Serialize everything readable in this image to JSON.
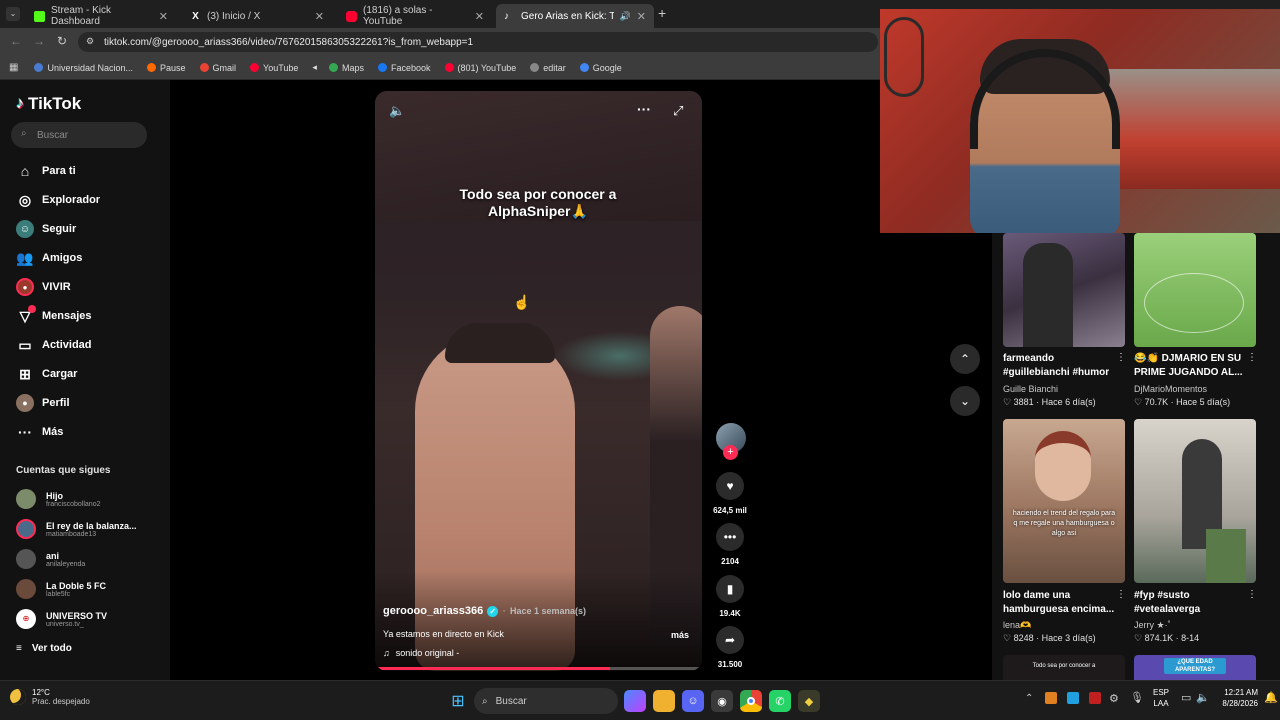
{
  "browser": {
    "tabs": [
      {
        "title": "Stream - Kick Dashboard",
        "icon": "kick-icon",
        "color": "#53fc18"
      },
      {
        "title": "(3) Inicio / X",
        "icon": "x-icon",
        "color": "#ffffff"
      },
      {
        "title": "(1816) a solas - YouTube",
        "icon": "youtube-icon",
        "color": "#ff0033"
      },
      {
        "title": "Gero Arias en Kick: Todo se",
        "icon": "tiktok-icon",
        "color": "#ffffff"
      }
    ],
    "url": "tiktok.com/@geroooo_ariass366/video/7676201586305322261?is_from_webapp=1",
    "bookmarks": [
      {
        "label": "Universidad Nacion...",
        "color": "#4a7bd0"
      },
      {
        "label": "Pause",
        "color": "#ff6a00"
      },
      {
        "label": "Gmail",
        "color": "#ea4335"
      },
      {
        "label": "YouTube",
        "color": "#ff0033"
      },
      {
        "label": "Maps",
        "color": "#34a853"
      },
      {
        "label": "Facebook",
        "color": "#1877f2"
      },
      {
        "label": "(801) YouTube",
        "color": "#ff0033"
      },
      {
        "label": "editar",
        "color": "#888888"
      },
      {
        "label": "Google",
        "color": "#4285f4"
      }
    ]
  },
  "sidebar": {
    "logo": "TikTok",
    "search_placeholder": "Buscar",
    "nav": [
      {
        "label": "Para ti",
        "icon": "home-icon"
      },
      {
        "label": "Explorador",
        "icon": "compass-icon"
      },
      {
        "label": "Seguir",
        "icon": "following-icon"
      },
      {
        "label": "Amigos",
        "icon": "friends-icon"
      },
      {
        "label": "VIVIR",
        "icon": "live-icon"
      },
      {
        "label": "Mensajes",
        "icon": "messages-icon"
      },
      {
        "label": "Actividad",
        "icon": "activity-icon"
      },
      {
        "label": "Cargar",
        "icon": "upload-icon"
      },
      {
        "label": "Perfil",
        "icon": "profile-icon"
      },
      {
        "label": "Más",
        "icon": "more-icon"
      }
    ],
    "following_title": "Cuentas que sigues",
    "following": [
      {
        "name": "Hijo",
        "handle": "franciscobollano2"
      },
      {
        "name": "El rey de la balanza...",
        "handle": "matiamboade13"
      },
      {
        "name": "ani",
        "handle": "anilaleyenda"
      },
      {
        "name": "La Doble 5 FC",
        "handle": "lable5fc"
      },
      {
        "name": "UNIVERSO TV",
        "handle": "universo.tv_"
      }
    ],
    "see_all": "Ver todo"
  },
  "video": {
    "caption_overlay": "Todo sea por conocer a AlphaSniper🙏",
    "author": "geroooo_ariass366",
    "time": "Hace 1 semana(s)",
    "description": "Ya estamos en directo en Kick",
    "more": "más",
    "sound": "sonido original -",
    "likes": "624,5 mil",
    "comments": "2104",
    "saves": "19.4K",
    "shares": "31.500"
  },
  "grid": [
    {
      "title": "farmeando #guillebianchi #humor",
      "author": "Guille Bianchi",
      "likes": "3881",
      "time": "Hace 6 día(s)"
    },
    {
      "title": "😂👏 DJMARIO EN SU PRIME JUGANDO AL...",
      "author": "DjMarioMomentos",
      "likes": "70.7K",
      "time": "Hace 5 día(s)"
    },
    {
      "title": "lolo dame una hamburguesa encima...",
      "author": "lena🫶",
      "likes": "8248",
      "time": "Hace 3 día(s)",
      "overlay": "haciendo el trend del regalo para q me regale una hamburguesa o algo asi"
    },
    {
      "title": "#fyp #susto #vetealaverga",
      "author": "Jerry ★·˚",
      "likes": "874.1K",
      "time": "8-14"
    }
  ],
  "grid_bottom_overlays": [
    "Todo sea por conocer a",
    "¿QUE EDAD APARENTAS?"
  ],
  "taskbar": {
    "weather_temp": "12°C",
    "weather_desc": "Prac. despejado",
    "search": "Buscar",
    "lang": "ESP",
    "lang2": "LAA",
    "time": "12:21 AM",
    "date": "8/28/2026"
  }
}
